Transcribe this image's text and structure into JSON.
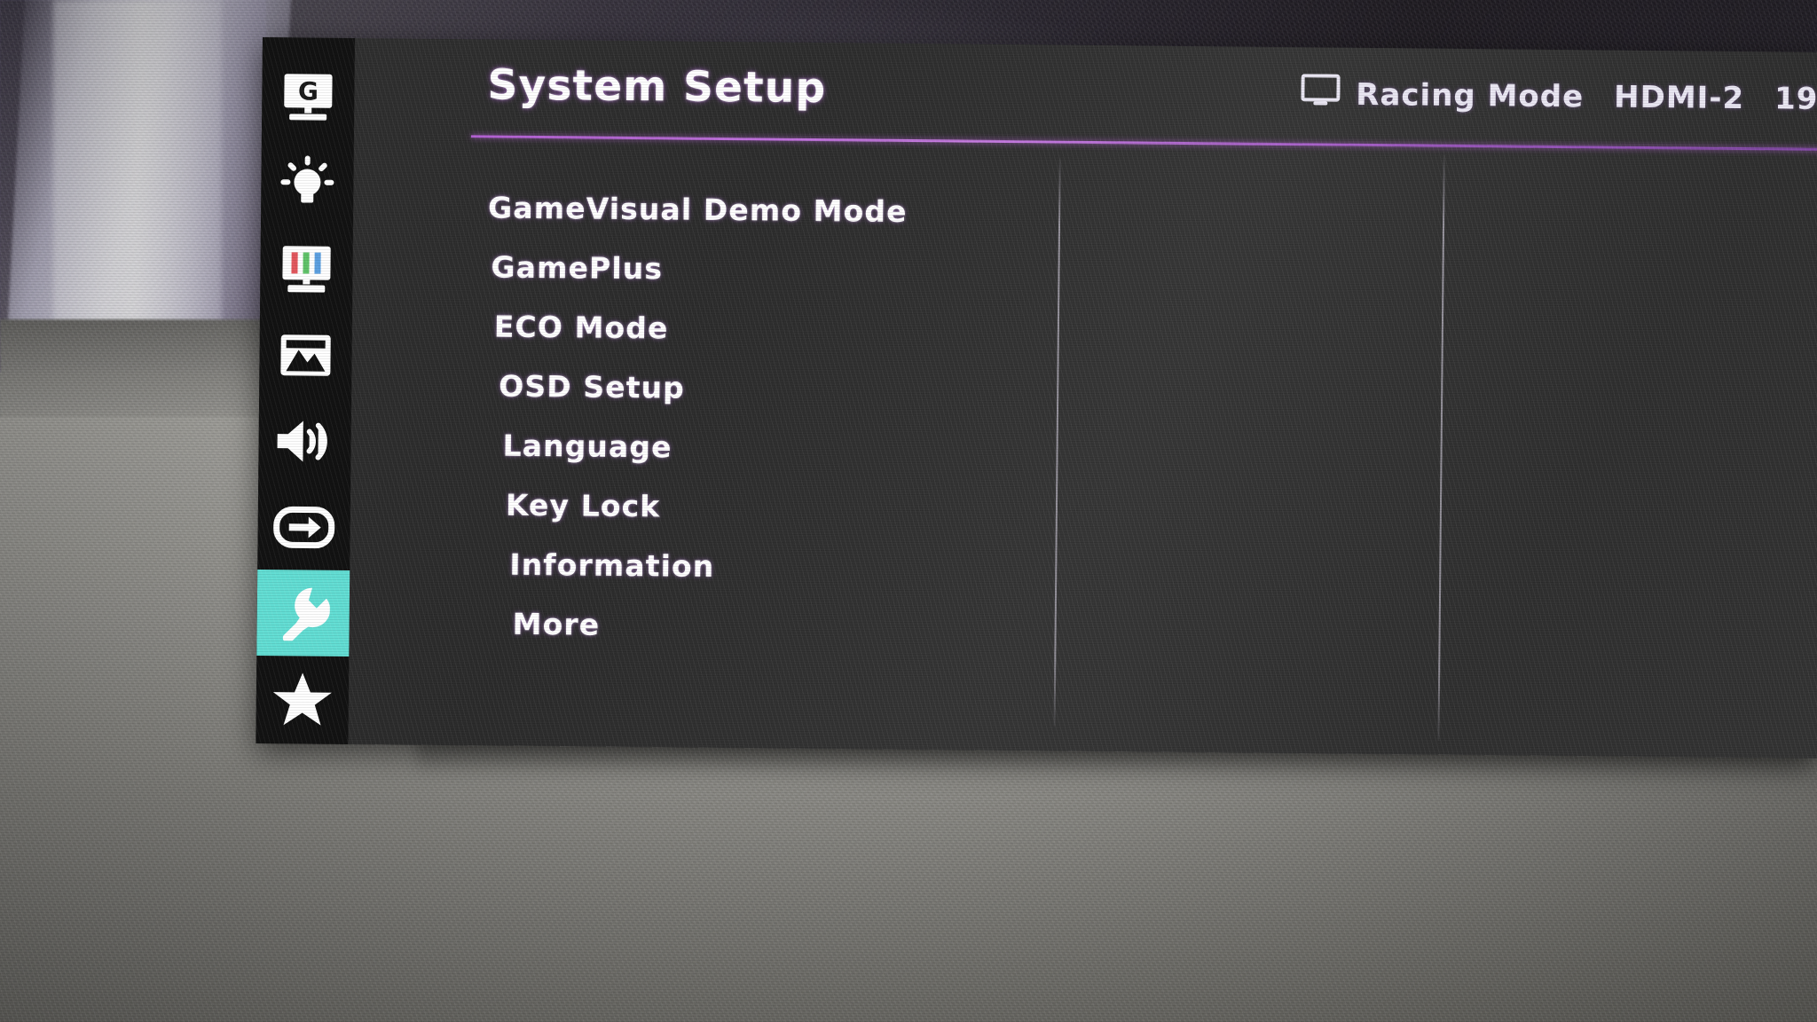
{
  "window": {
    "title": "System Setup"
  },
  "status_bar": {
    "monitor_icon": "monitor-icon",
    "preset_mode": "Racing Mode",
    "input_source": "HDMI-2",
    "resolution": "19"
  },
  "sidebar": {
    "active_index": 6,
    "items": [
      {
        "icon": "gamevisual-monitor-g-icon",
        "name": "gamevisual",
        "active": false
      },
      {
        "icon": "blue-light-bulb-icon",
        "name": "blue-light-filter",
        "active": false
      },
      {
        "icon": "color-bars-icon",
        "name": "color",
        "active": false
      },
      {
        "icon": "picture-image-icon",
        "name": "image",
        "active": false
      },
      {
        "icon": "speaker-sound-icon",
        "name": "sound",
        "active": false
      },
      {
        "icon": "input-select-arrow-icon",
        "name": "input-select",
        "active": false
      },
      {
        "icon": "wrench-system-setup-icon",
        "name": "system-setup",
        "active": true
      },
      {
        "icon": "star-myfavorite-icon",
        "name": "myfavorite",
        "active": false
      }
    ]
  },
  "menu": {
    "items": [
      {
        "label": "GameVisual Demo Mode"
      },
      {
        "label": "GamePlus"
      },
      {
        "label": "ECO Mode"
      },
      {
        "label": "OSD Setup"
      },
      {
        "label": "Language"
      },
      {
        "label": "Key Lock"
      },
      {
        "label": "Information"
      },
      {
        "label": "More"
      }
    ]
  },
  "colors": {
    "accent_teal": "#62ddd3",
    "title_rule_purple": "#b05fd0",
    "panel_bg": "#313131",
    "rail_bg": "#121212",
    "text": "#ffffff"
  }
}
